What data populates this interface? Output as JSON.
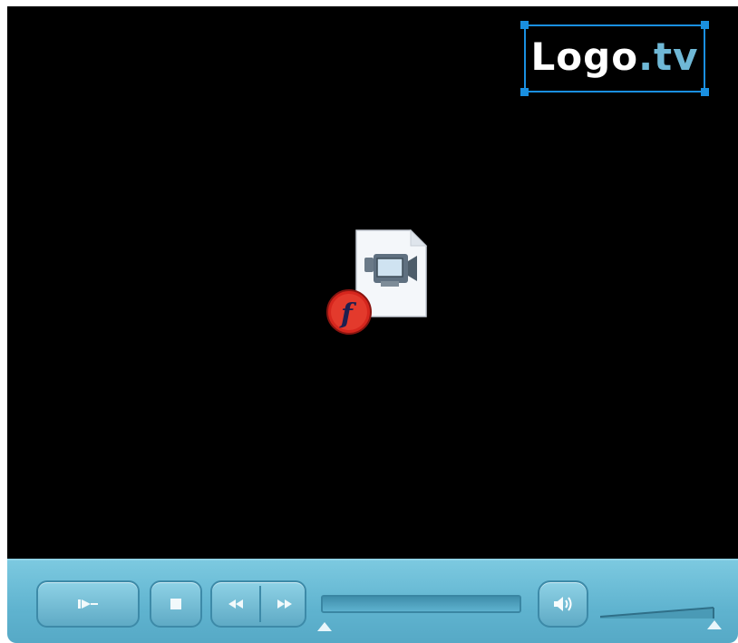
{
  "video_area": {
    "logo": {
      "main": "Logo",
      "suffix": ".tv"
    },
    "center_icon": "flash-video-file-icon"
  },
  "controls": {
    "play_icon": "play-icon",
    "stop_icon": "stop-icon",
    "rewind_icon": "rewind-icon",
    "fast_forward_icon": "fast-forward-icon",
    "mute_icon": "speaker-icon",
    "progress": 0,
    "volume": 1.0
  },
  "colors": {
    "control_bar": "#5fb3cf",
    "selection_handles": "#1a8fe0",
    "logo_suffix": "#6fb8d6"
  }
}
